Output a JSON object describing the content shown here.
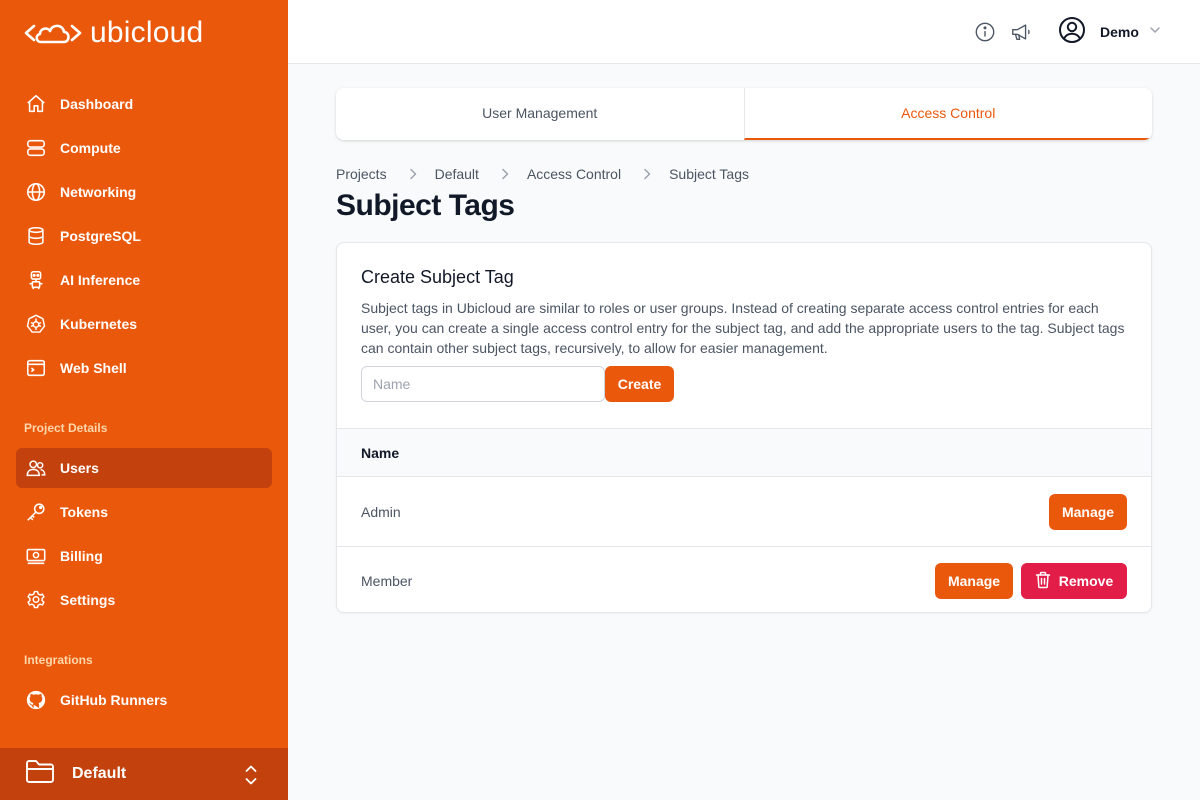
{
  "brand": {
    "name": "ubicloud"
  },
  "sidebar": {
    "main_items": [
      {
        "label": "Dashboard",
        "icon": "home-icon"
      },
      {
        "label": "Compute",
        "icon": "server-icon"
      },
      {
        "label": "Networking",
        "icon": "globe-icon"
      },
      {
        "label": "PostgreSQL",
        "icon": "database-icon"
      },
      {
        "label": "AI Inference",
        "icon": "robot-icon"
      },
      {
        "label": "Kubernetes",
        "icon": "kubernetes-icon"
      },
      {
        "label": "Web Shell",
        "icon": "terminal-icon"
      }
    ],
    "project_details_title": "Project Details",
    "project_items": [
      {
        "label": "Users",
        "icon": "users-icon",
        "active": true
      },
      {
        "label": "Tokens",
        "icon": "key-icon"
      },
      {
        "label": "Billing",
        "icon": "banknote-icon"
      },
      {
        "label": "Settings",
        "icon": "gear-icon"
      }
    ],
    "integrations_title": "Integrations",
    "integration_items": [
      {
        "label": "GitHub Runners",
        "icon": "github-icon"
      }
    ],
    "project_switcher": {
      "label": "Default",
      "icon": "folder-icon"
    }
  },
  "topbar": {
    "user_name": "Demo"
  },
  "tabs": [
    {
      "label": "User Management",
      "active": false
    },
    {
      "label": "Access Control",
      "active": true
    }
  ],
  "breadcrumb": [
    "Projects",
    "Default",
    "Access Control",
    "Subject Tags"
  ],
  "page_title": "Subject Tags",
  "create_card": {
    "title": "Create Subject Tag",
    "description": "Subject tags in Ubicloud are similar to roles or user groups. Instead of creating separate access control entries for each user, you can create a single access control entry for the subject tag, and add the appropriate users to the tag. Subject tags can contain other subject tags, recursively, to allow for easier management.",
    "input_placeholder": "Name",
    "input_value": "",
    "create_label": "Create"
  },
  "table": {
    "header": "Name",
    "rows": [
      {
        "name": "Admin",
        "manage_label": "Manage"
      },
      {
        "name": "Member",
        "manage_label": "Manage",
        "remove_label": "Remove"
      }
    ]
  },
  "colors": {
    "brand_orange": "#ea580c",
    "brand_orange_dark": "#c2410c",
    "remove_red": "#e11d48"
  }
}
